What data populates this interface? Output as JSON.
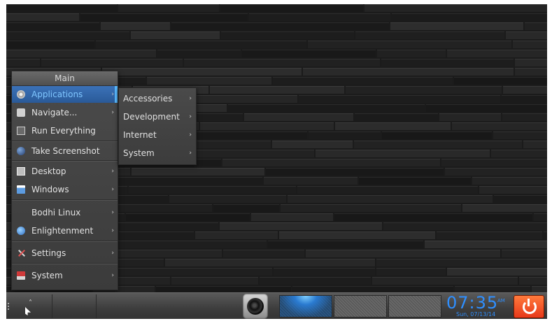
{
  "main_menu": {
    "title": "Main",
    "items": [
      {
        "label": "Applications",
        "icon": "gear-icon",
        "submenu": true,
        "selected": true
      },
      {
        "label": "Navigate...",
        "icon": "navigate-icon",
        "submenu": true
      },
      {
        "label": "Run Everything",
        "icon": "run-everything-icon",
        "submenu": false
      },
      {
        "label": "Take Screenshot",
        "icon": "screenshot-icon",
        "submenu": false
      },
      {
        "label": "Desktop",
        "icon": "desktop-icon",
        "submenu": true
      },
      {
        "label": "Windows",
        "icon": "windows-icon",
        "submenu": true
      },
      {
        "label": "Bodhi Linux",
        "icon": "",
        "submenu": true
      },
      {
        "label": "Enlightenment",
        "icon": "enlightenment-icon",
        "submenu": true
      },
      {
        "label": "Settings",
        "icon": "settings-icon",
        "submenu": true
      },
      {
        "label": "System",
        "icon": "system-icon",
        "submenu": true
      }
    ],
    "arrow": "›"
  },
  "applications_submenu": {
    "items": [
      {
        "label": "Accessories"
      },
      {
        "label": "Development"
      },
      {
        "label": "Internet"
      },
      {
        "label": "System"
      }
    ],
    "arrow": "›"
  },
  "shelf": {
    "launcher_arrow": "˄",
    "clock": {
      "time": "07:35",
      "ampm": "AM",
      "date": "Sun, 07/13/14"
    }
  },
  "colors": {
    "selection": "#2a5a98",
    "clock": "#2f8fff",
    "power": "#e8391a"
  }
}
